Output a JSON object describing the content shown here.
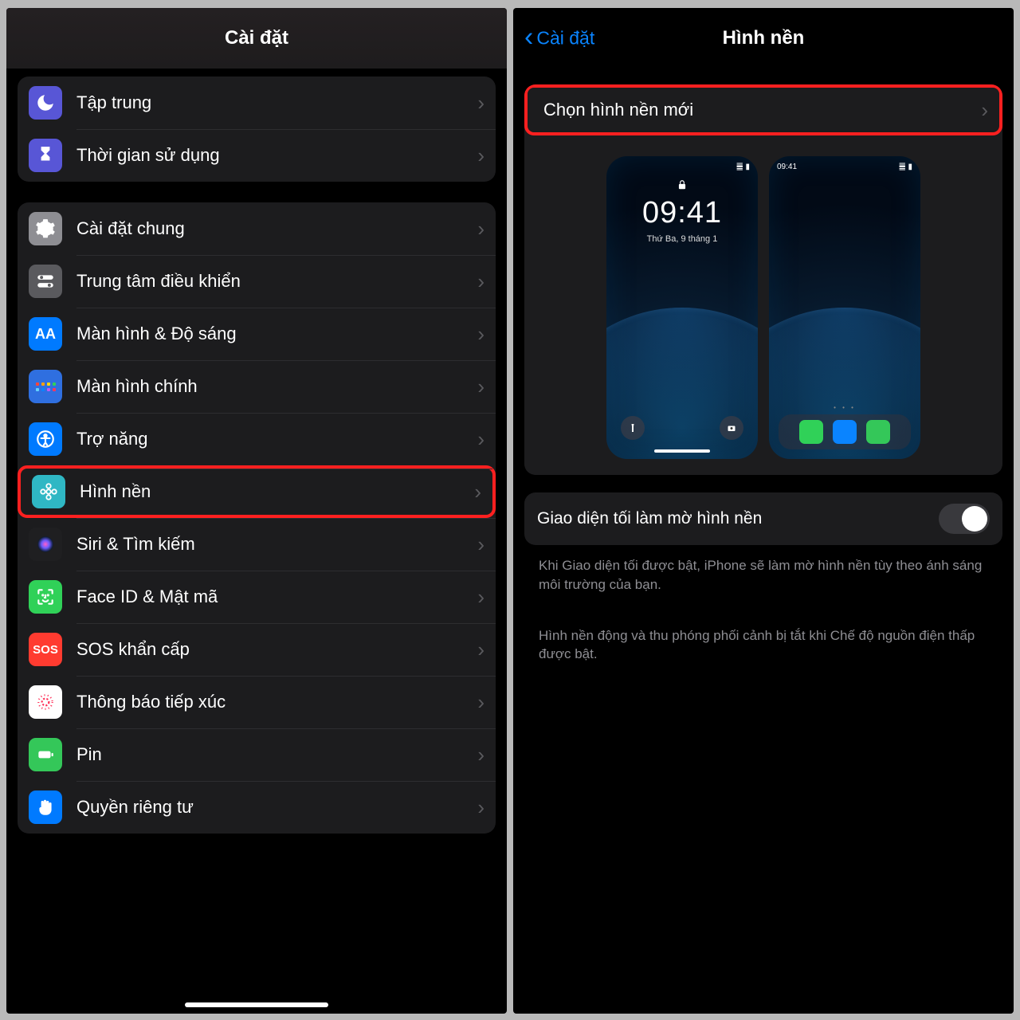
{
  "left": {
    "title": "Cài đặt",
    "group1": [
      {
        "label": "Tập trung",
        "name": "focus"
      },
      {
        "label": "Thời gian sử dụng",
        "name": "screen-time"
      }
    ],
    "group2": [
      {
        "label": "Cài đặt chung",
        "name": "general"
      },
      {
        "label": "Trung tâm điều khiển",
        "name": "control-center"
      },
      {
        "label": "Màn hình & Độ sáng",
        "name": "display-brightness"
      },
      {
        "label": "Màn hình chính",
        "name": "home-screen"
      },
      {
        "label": "Trợ năng",
        "name": "accessibility"
      },
      {
        "label": "Hình nền",
        "name": "wallpaper",
        "highlight": true
      },
      {
        "label": "Siri & Tìm kiếm",
        "name": "siri-search"
      },
      {
        "label": "Face ID & Mật mã",
        "name": "faceid-passcode"
      },
      {
        "label": "SOS khẩn cấp",
        "name": "emergency-sos"
      },
      {
        "label": "Thông báo tiếp xúc",
        "name": "exposure-notification"
      },
      {
        "label": "Pin",
        "name": "battery"
      },
      {
        "label": "Quyền riêng tư",
        "name": "privacy"
      }
    ]
  },
  "right": {
    "back": "Cài đặt",
    "title": "Hình nền",
    "choose": "Chọn hình nền mới",
    "lock_time": "09:41",
    "lock_date": "Thứ Ba, 9 tháng 1",
    "status_time": "09:41",
    "toggle_label": "Giao diện tối làm mờ hình nền",
    "note1": "Khi Giao diện tối được bật, iPhone sẽ làm mờ hình nền tùy theo ánh sáng môi trường của bạn.",
    "note2": "Hình nền động và thu phóng phối cảnh bị tắt khi Chế độ nguồn điện thấp được bật."
  }
}
